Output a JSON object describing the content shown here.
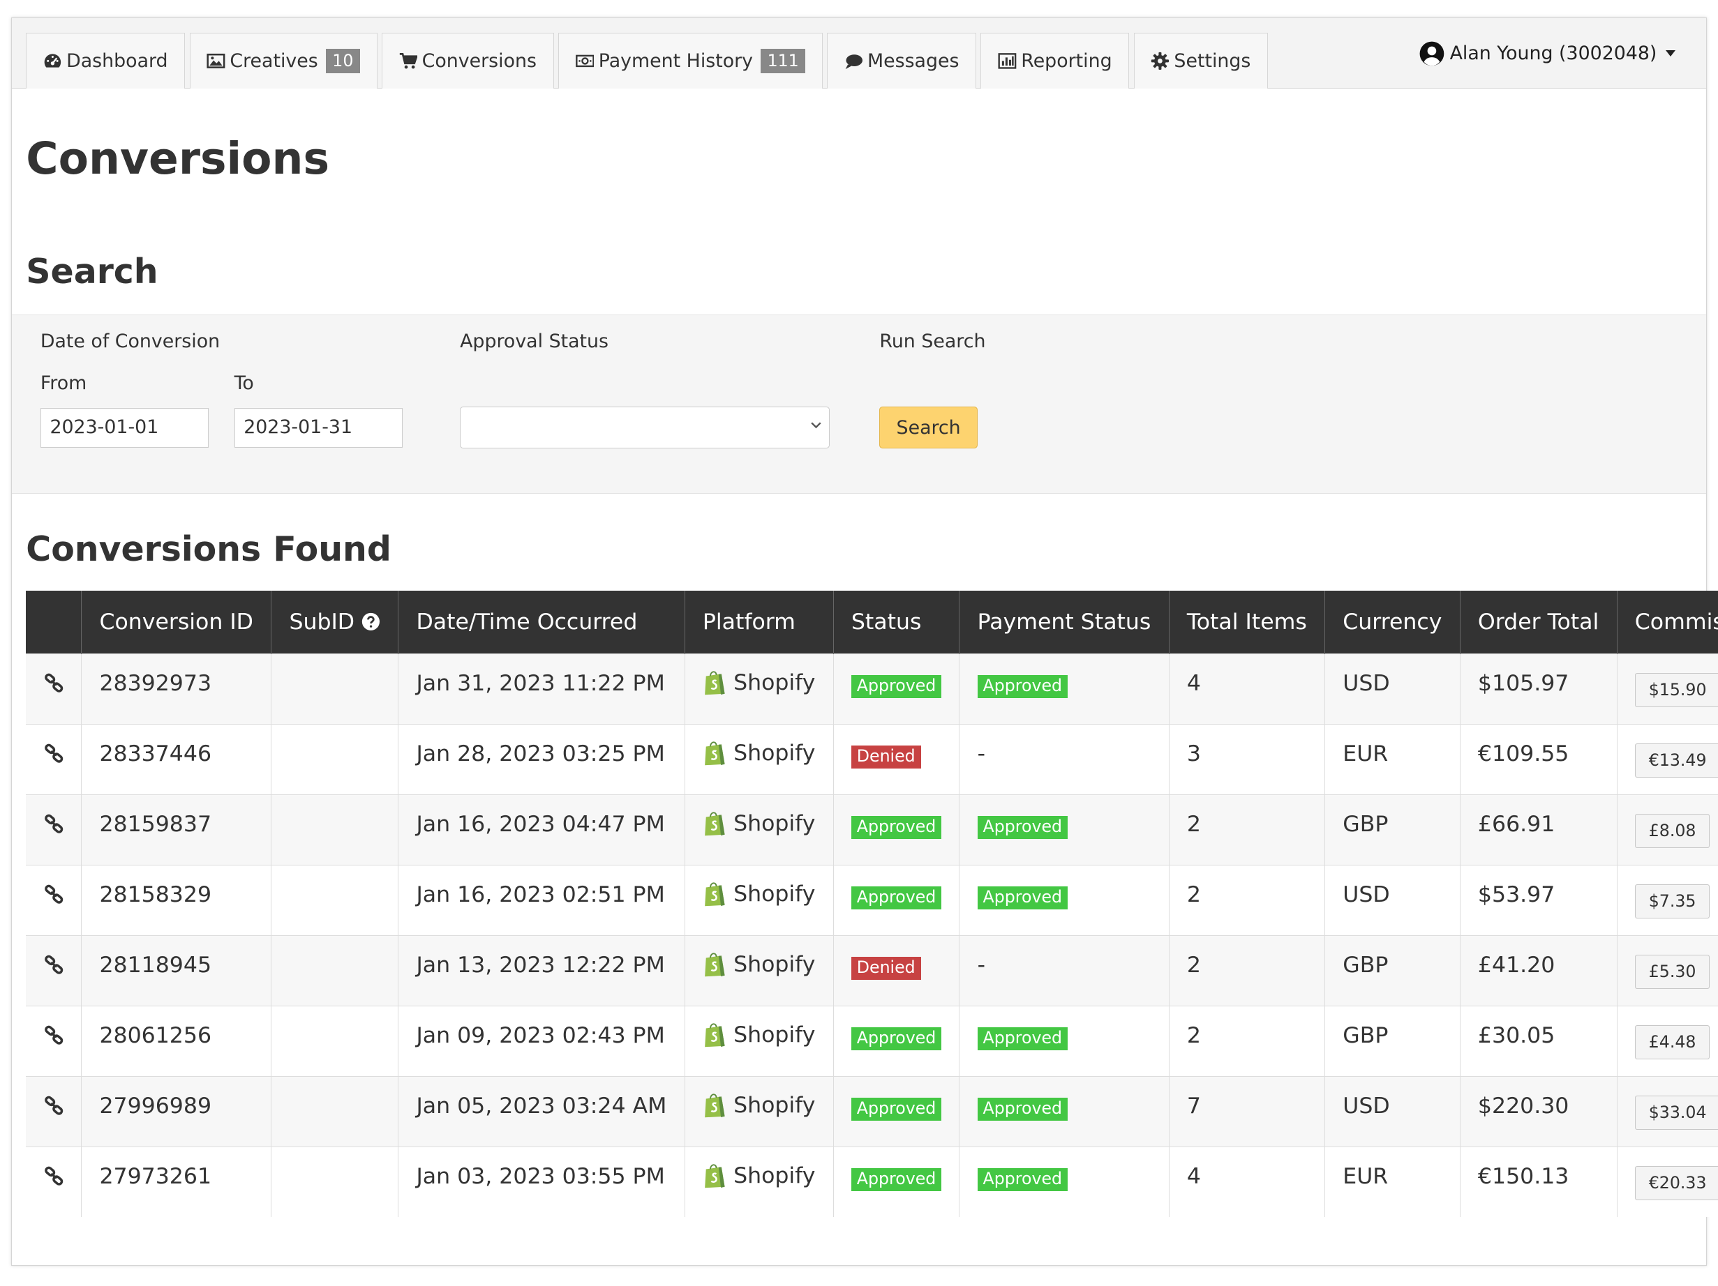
{
  "nav": {
    "tabs": [
      {
        "label": "Dashboard",
        "icon": "dashboard-icon"
      },
      {
        "label": "Creatives",
        "icon": "image-icon",
        "badge": "10"
      },
      {
        "label": "Conversions",
        "icon": "cart-icon"
      },
      {
        "label": "Payment History",
        "icon": "money-icon",
        "badge": "111"
      },
      {
        "label": "Messages",
        "icon": "chat-icon"
      },
      {
        "label": "Reporting",
        "icon": "bar-chart-icon"
      },
      {
        "label": "Settings",
        "icon": "gear-icon"
      }
    ],
    "user": "Alan Young (3002048)"
  },
  "page_title": "Conversions",
  "search": {
    "heading": "Search",
    "date_label": "Date of Conversion",
    "from_label": "From",
    "to_label": "To",
    "from_value": "2023-01-01",
    "to_value": "2023-01-31",
    "approval_label": "Approval Status",
    "approval_value": "",
    "run_label": "Run Search",
    "button": "Search"
  },
  "results": {
    "heading": "Conversions Found",
    "columns": [
      "",
      "Conversion ID",
      "SubID",
      "Date/Time Occurred",
      "Platform",
      "Status",
      "Payment Status",
      "Total Items",
      "Currency",
      "Order Total",
      "Commission"
    ],
    "rows": [
      {
        "id": "28392973",
        "subid": "",
        "date": "Jan 31, 2023 11:22 PM",
        "platform": "Shopify",
        "status": "Approved",
        "payment": "Approved",
        "items": "4",
        "currency": "USD",
        "total": "$105.97",
        "commission": "$15.90"
      },
      {
        "id": "28337446",
        "subid": "",
        "date": "Jan 28, 2023 03:25 PM",
        "platform": "Shopify",
        "status": "Denied",
        "payment": "-",
        "items": "3",
        "currency": "EUR",
        "total": "€109.55",
        "commission": "€13.49"
      },
      {
        "id": "28159837",
        "subid": "",
        "date": "Jan 16, 2023 04:47 PM",
        "platform": "Shopify",
        "status": "Approved",
        "payment": "Approved",
        "items": "2",
        "currency": "GBP",
        "total": "£66.91",
        "commission": "£8.08"
      },
      {
        "id": "28158329",
        "subid": "",
        "date": "Jan 16, 2023 02:51 PM",
        "platform": "Shopify",
        "status": "Approved",
        "payment": "Approved",
        "items": "2",
        "currency": "USD",
        "total": "$53.97",
        "commission": "$7.35"
      },
      {
        "id": "28118945",
        "subid": "",
        "date": "Jan 13, 2023 12:22 PM",
        "platform": "Shopify",
        "status": "Denied",
        "payment": "-",
        "items": "2",
        "currency": "GBP",
        "total": "£41.20",
        "commission": "£5.30"
      },
      {
        "id": "28061256",
        "subid": "",
        "date": "Jan 09, 2023 02:43 PM",
        "platform": "Shopify",
        "status": "Approved",
        "payment": "Approved",
        "items": "2",
        "currency": "GBP",
        "total": "£30.05",
        "commission": "£4.48"
      },
      {
        "id": "27996989",
        "subid": "",
        "date": "Jan 05, 2023 03:24 AM",
        "platform": "Shopify",
        "status": "Approved",
        "payment": "Approved",
        "items": "7",
        "currency": "USD",
        "total": "$220.30",
        "commission": "$33.04"
      },
      {
        "id": "27973261",
        "subid": "",
        "date": "Jan 03, 2023 03:55 PM",
        "platform": "Shopify",
        "status": "Approved",
        "payment": "Approved",
        "items": "4",
        "currency": "EUR",
        "total": "€150.13",
        "commission": "€20.33"
      }
    ]
  },
  "colors": {
    "approved": "#43c743",
    "denied": "#c74242",
    "header": "#333333",
    "search_button": "#fdd36f"
  }
}
